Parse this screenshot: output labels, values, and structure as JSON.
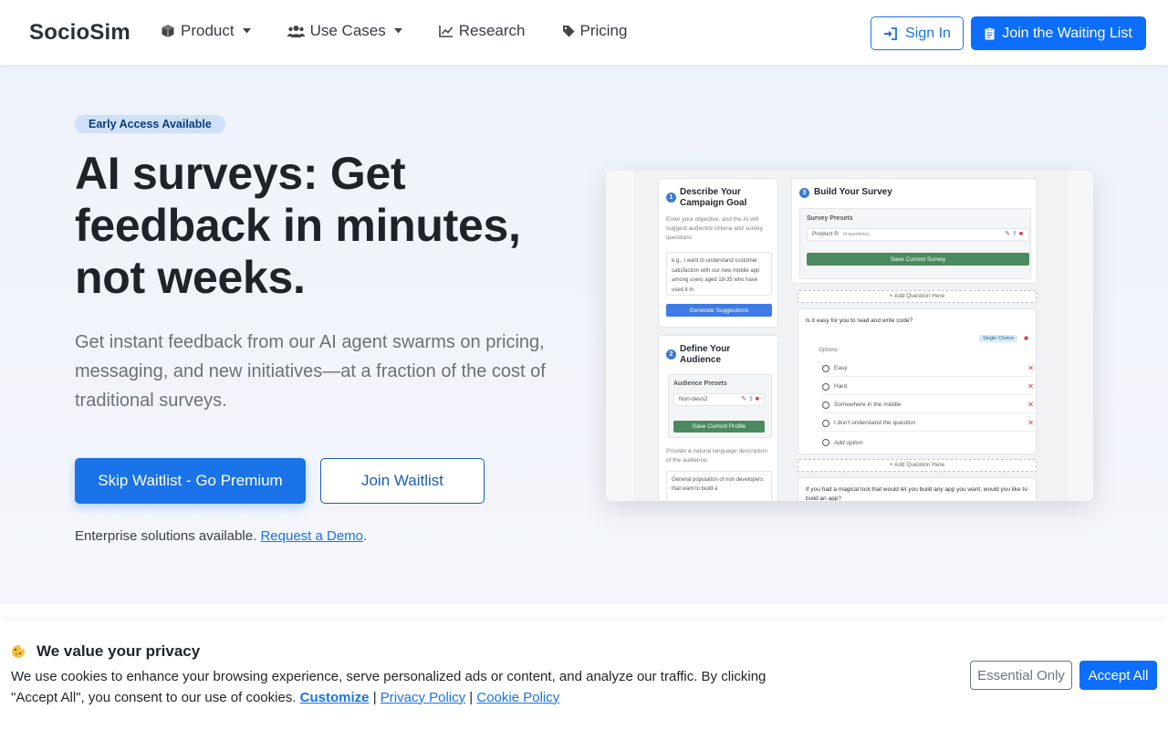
{
  "nav": {
    "brand": "SocioSim",
    "items": [
      {
        "label": "Product",
        "icon": "cube-icon",
        "dropdown": true
      },
      {
        "label": "Use Cases",
        "icon": "users-icon",
        "dropdown": true
      },
      {
        "label": "Research",
        "icon": "chart-line-icon",
        "dropdown": false
      },
      {
        "label": "Pricing",
        "icon": "tag-icon",
        "dropdown": false
      }
    ],
    "sign_in": "Sign In",
    "join_waitlist": "Join the Waiting List"
  },
  "hero": {
    "badge": "Early Access Available",
    "headline": "AI surveys: Get feedback in minutes, not weeks.",
    "subheadline": "Get instant feedback from our AI agent swarms on pricing, messaging, and new initiatives—at a fraction of the cost of traditional surveys.",
    "primary_cta": "Skip Waitlist - Go Premium",
    "secondary_cta": "Join Waitlist",
    "enterprise_text": "Enterprise solutions available.",
    "demo_link": "Request a Demo",
    "enterprise_suffix": "."
  },
  "mock": {
    "step1": {
      "num": "1",
      "title": "Describe Your Campaign Goal",
      "help": "Enter your objective, and the AI will suggest audience criteria and survey questions.",
      "example": "e.g., I want to understand customer satisfaction with our new mobile app among users aged 18-35 who have used it in",
      "button": "Generate Suggestions"
    },
    "step2": {
      "num": "2",
      "title": "Define Your Audience",
      "presets_label": "Audience Presets",
      "preset": "Non-devs2",
      "save": "Save Current Profile",
      "desc_label": "Provide a natural language description of the audience:",
      "desc": "General population of non developers, that want to build a"
    },
    "step3": {
      "num": "3",
      "title": "Build Your Survey",
      "presets_label": "Survey Presets",
      "preset": "Product R",
      "preset_meta": "(4 questions)",
      "save": "Save Current Survey",
      "add_here": "+ Add Question Here",
      "q1": "Is it easy for you to read and write code?",
      "q1_type": "Single Choice",
      "options_label": "Options",
      "options": [
        "Easy",
        "Hard",
        "Somewhere in the middle",
        "I don't understand the question"
      ],
      "add_option": "Add option",
      "q2": "If you had a magical tool that would let you build any app you want, would you like to build an app?"
    }
  },
  "cookie": {
    "title": "We value your privacy",
    "text": "We use cookies to enhance your browsing experience, serve personalized ads or content, and analyze our traffic. By clicking \"Accept All\", you consent to our use of cookies.",
    "customize": "Customize",
    "privacy": "Privacy Policy",
    "cookie_policy": "Cookie Policy",
    "separator": "|",
    "essential": "Essential Only",
    "accept": "Accept All"
  }
}
